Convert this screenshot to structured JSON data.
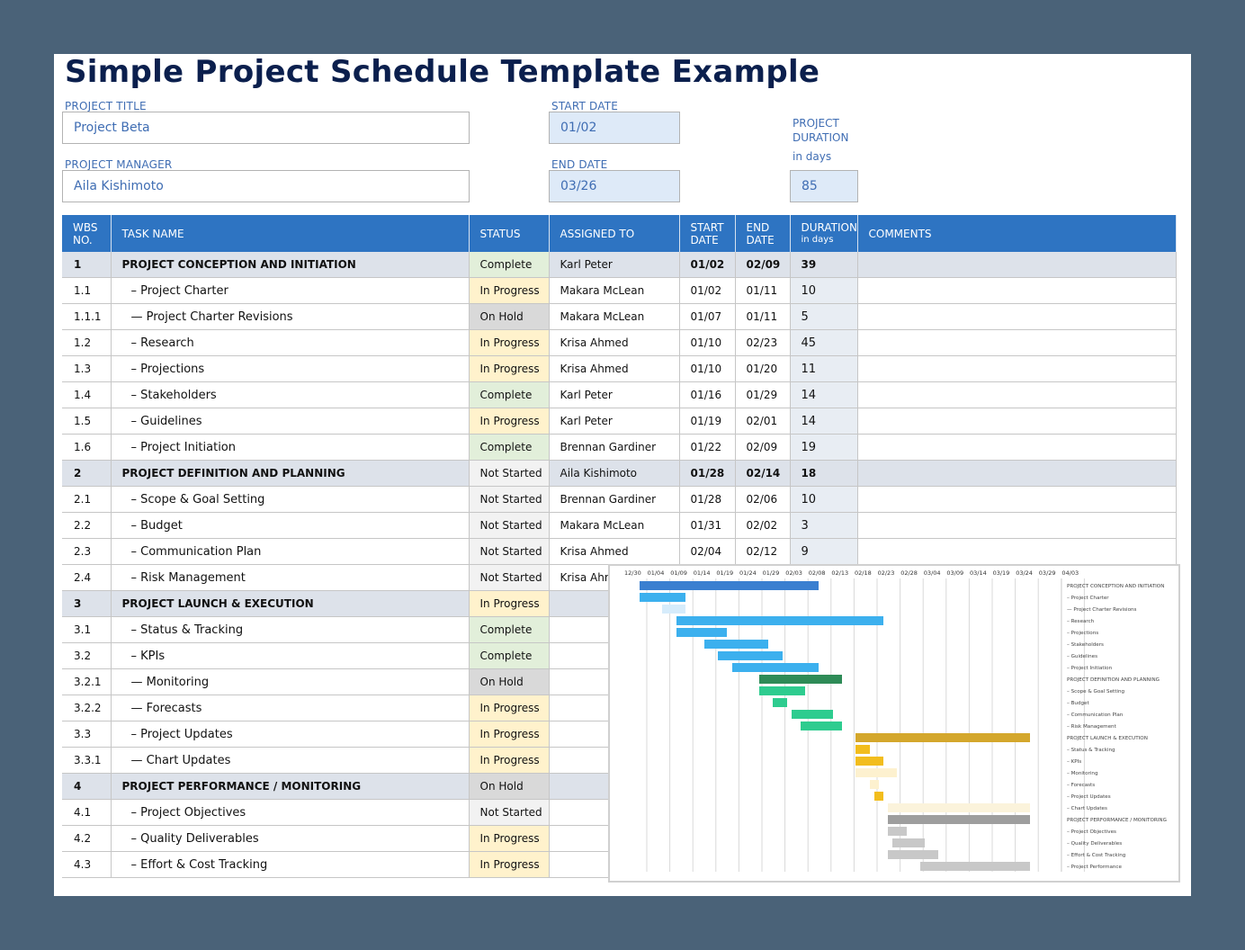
{
  "title": "Simple Project Schedule Template Example",
  "fields": {
    "project_title_label": "PROJECT TITLE",
    "project_title_value": "Project Beta",
    "project_manager_label": "PROJECT MANAGER",
    "project_manager_value": "Aila Kishimoto",
    "start_date_label": "START DATE",
    "start_date_value": "01/02",
    "end_date_label": "END DATE",
    "end_date_value": "03/26",
    "duration_label_line1": "PROJECT",
    "duration_label_line2": "DURATION",
    "duration_sublabel": "in days",
    "duration_value": "85"
  },
  "table": {
    "headers": {
      "wbs_line1": "WBS",
      "wbs_line2": "NO.",
      "task": "TASK NAME",
      "status": "STATUS",
      "assigned": "ASSIGNED TO",
      "start_line1": "START",
      "start_line2": "DATE",
      "end_line1": "END",
      "end_line2": "DATE",
      "duration_line1": "DURATION",
      "duration_line2": "in days",
      "comments": "COMMENTS"
    },
    "rows": [
      {
        "wbs": "1",
        "task": "PROJECT CONCEPTION AND INITIATION",
        "status": "Complete",
        "assigned": "Karl Peter",
        "start": "01/02",
        "end": "02/09",
        "duration": "39",
        "phase": true
      },
      {
        "wbs": "1.1",
        "task": "– Project Charter",
        "status": "In Progress",
        "assigned": "Makara McLean",
        "start": "01/02",
        "end": "01/11",
        "duration": "10",
        "phase": false
      },
      {
        "wbs": "1.1.1",
        "task": "— Project Charter Revisions",
        "status": "On Hold",
        "assigned": "Makara McLean",
        "start": "01/07",
        "end": "01/11",
        "duration": "5",
        "phase": false
      },
      {
        "wbs": "1.2",
        "task": "– Research",
        "status": "In Progress",
        "assigned": "Krisa Ahmed",
        "start": "01/10",
        "end": "02/23",
        "duration": "45",
        "phase": false
      },
      {
        "wbs": "1.3",
        "task": "– Projections",
        "status": "In Progress",
        "assigned": "Krisa Ahmed",
        "start": "01/10",
        "end": "01/20",
        "duration": "11",
        "phase": false
      },
      {
        "wbs": "1.4",
        "task": "– Stakeholders",
        "status": "Complete",
        "assigned": "Karl Peter",
        "start": "01/16",
        "end": "01/29",
        "duration": "14",
        "phase": false
      },
      {
        "wbs": "1.5",
        "task": "– Guidelines",
        "status": "In Progress",
        "assigned": "Karl Peter",
        "start": "01/19",
        "end": "02/01",
        "duration": "14",
        "phase": false
      },
      {
        "wbs": "1.6",
        "task": "– Project Initiation",
        "status": "Complete",
        "assigned": "Brennan Gardiner",
        "start": "01/22",
        "end": "02/09",
        "duration": "19",
        "phase": false
      },
      {
        "wbs": "2",
        "task": "PROJECT DEFINITION AND PLANNING",
        "status": "Not Started",
        "assigned": "Aila Kishimoto",
        "start": "01/28",
        "end": "02/14",
        "duration": "18",
        "phase": true
      },
      {
        "wbs": "2.1",
        "task": "– Scope & Goal Setting",
        "status": "Not Started",
        "assigned": "Brennan Gardiner",
        "start": "01/28",
        "end": "02/06",
        "duration": "10",
        "phase": false
      },
      {
        "wbs": "2.2",
        "task": "– Budget",
        "status": "Not Started",
        "assigned": "Makara McLean",
        "start": "01/31",
        "end": "02/02",
        "duration": "3",
        "phase": false
      },
      {
        "wbs": "2.3",
        "task": "– Communication Plan",
        "status": "Not Started",
        "assigned": "Krisa Ahmed",
        "start": "02/04",
        "end": "02/12",
        "duration": "9",
        "phase": false
      },
      {
        "wbs": "2.4",
        "task": "– Risk Management",
        "status": "Not Started",
        "assigned": "Krisa Ahmed",
        "start": "",
        "end": "",
        "duration": "",
        "phase": false
      },
      {
        "wbs": "3",
        "task": "PROJECT LAUNCH & EXECUTION",
        "status": "In Progress",
        "assigned": "",
        "start": "",
        "end": "",
        "duration": "",
        "phase": true
      },
      {
        "wbs": "3.1",
        "task": "– Status & Tracking",
        "status": "Complete",
        "assigned": "",
        "start": "",
        "end": "",
        "duration": "",
        "phase": false
      },
      {
        "wbs": "3.2",
        "task": "– KPIs",
        "status": "Complete",
        "assigned": "",
        "start": "",
        "end": "",
        "duration": "",
        "phase": false
      },
      {
        "wbs": "3.2.1",
        "task": "— Monitoring",
        "status": "On Hold",
        "assigned": "",
        "start": "",
        "end": "",
        "duration": "",
        "phase": false
      },
      {
        "wbs": "3.2.2",
        "task": "— Forecasts",
        "status": "In Progress",
        "assigned": "",
        "start": "",
        "end": "",
        "duration": "",
        "phase": false
      },
      {
        "wbs": "3.3",
        "task": "– Project Updates",
        "status": "In Progress",
        "assigned": "",
        "start": "",
        "end": "",
        "duration": "",
        "phase": false
      },
      {
        "wbs": "3.3.1",
        "task": "— Chart Updates",
        "status": "In Progress",
        "assigned": "",
        "start": "",
        "end": "",
        "duration": "",
        "phase": false
      },
      {
        "wbs": "4",
        "task": "PROJECT PERFORMANCE / MONITORING",
        "status": "On Hold",
        "assigned": "",
        "start": "",
        "end": "",
        "duration": "",
        "phase": true
      },
      {
        "wbs": "4.1",
        "task": "– Project Objectives",
        "status": "Not Started",
        "assigned": "",
        "start": "",
        "end": "",
        "duration": "",
        "phase": false
      },
      {
        "wbs": "4.2",
        "task": "– Quality Deliverables",
        "status": "In Progress",
        "assigned": "",
        "start": "",
        "end": "",
        "duration": "",
        "phase": false
      },
      {
        "wbs": "4.3",
        "task": "– Effort & Cost Tracking",
        "status": "In Progress",
        "assigned": "",
        "start": "",
        "end": "",
        "duration": "",
        "phase": false
      }
    ]
  },
  "gantt": {
    "date_ticks": [
      "12/30",
      "01/04",
      "01/09",
      "01/14",
      "01/19",
      "01/24",
      "01/29",
      "02/03",
      "02/08",
      "02/13",
      "02/18",
      "02/23",
      "02/28",
      "03/04",
      "03/09",
      "03/14",
      "03/19",
      "03/24",
      "03/29",
      "04/03"
    ],
    "task_labels": [
      "PROJECT CONCEPTION AND INITIATION",
      "– Project Charter",
      "— Project Charter Revisions",
      "– Research",
      "– Projections",
      "– Stakeholders",
      "– Guidelines",
      "– Project Initiation",
      "PROJECT DEFINITION AND PLANNING",
      "– Scope & Goal Setting",
      "– Budget",
      "– Communication Plan",
      "– Risk Management",
      "PROJECT LAUNCH & EXECUTION",
      "– Status & Tracking",
      "– KPIs",
      "– Monitoring",
      "– Forecasts",
      "– Project Updates",
      "– Chart Updates",
      "PROJECT PERFORMANCE / MONITORING",
      "– Project Objectives",
      "– Quality Deliverables",
      "– Effort & Cost Tracking",
      "– Project Performance"
    ],
    "colors": {
      "phase1": "#3a7fd0",
      "phase1_task": "#3cb0ee",
      "phase1_hold": "#d6ecfb",
      "phase2": "#2e8b57",
      "phase2_task": "#2ecc8f",
      "phase3": "#d4a72c",
      "phase3_task": "#f2bd1d",
      "phase3_light": "#fdf1cf",
      "phase4": "#9e9e9e",
      "phase4_task": "#c8c8c8",
      "phase4_light": "#fbf3db"
    }
  }
}
